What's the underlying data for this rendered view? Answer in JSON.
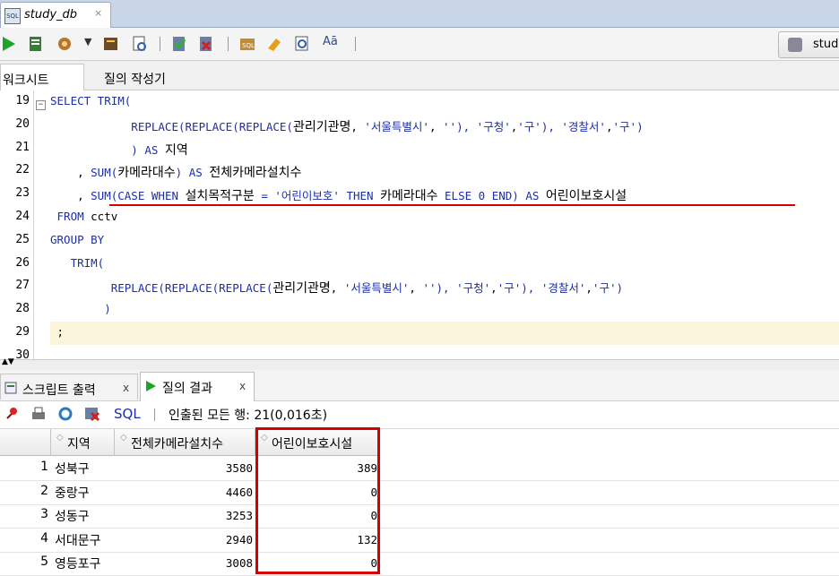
{
  "window": {
    "tab_title": "study_db",
    "tab_close": "×",
    "connection_label": "stud"
  },
  "subtabs": {
    "worksheet": "워크시트",
    "query_builder": "질의 작성기"
  },
  "editor": {
    "lines": [
      {
        "n": "19",
        "segs": [
          [
            "kw",
            "SELECT TRIM("
          ]
        ]
      },
      {
        "n": "20",
        "segs": [
          [
            "kw",
            "            REPLACE(REPLACE(REPLACE("
          ],
          [
            "kr",
            "관리기관명"
          ],
          [
            "plain",
            ", "
          ],
          [
            "str",
            "'서울특별시'"
          ],
          [
            "plain",
            ", "
          ],
          [
            "str",
            "''"
          ],
          [
            "kw",
            "), "
          ],
          [
            "str",
            "'구청'"
          ],
          [
            "plain",
            ","
          ],
          [
            "str",
            "'구'"
          ],
          [
            "kw",
            "), "
          ],
          [
            "str",
            "'경찰서'"
          ],
          [
            "plain",
            ","
          ],
          [
            "str",
            "'구'"
          ],
          [
            "kw",
            ")"
          ]
        ]
      },
      {
        "n": "21",
        "segs": [
          [
            "kw",
            "            ) AS "
          ],
          [
            "kr",
            "지역"
          ]
        ]
      },
      {
        "n": "22",
        "segs": [
          [
            "plain",
            "    , "
          ],
          [
            "kw",
            "SUM("
          ],
          [
            "kr",
            "카메라대수"
          ],
          [
            "kw",
            ") AS "
          ],
          [
            "kr",
            "전체카메라설치수"
          ]
        ]
      },
      {
        "n": "23",
        "segs": [
          [
            "plain",
            "    , "
          ],
          [
            "kw",
            "SUM(CASE WHEN "
          ],
          [
            "kr",
            "설치목적구분"
          ],
          [
            "kw",
            " = "
          ],
          [
            "str",
            "'어린이보호'"
          ],
          [
            "kw",
            " THEN "
          ],
          [
            "kr",
            "카메라대수"
          ],
          [
            "kw",
            " ELSE 0 END) AS "
          ],
          [
            "kr",
            "어린이보호시설"
          ]
        ]
      },
      {
        "n": "24",
        "segs": [
          [
            "kw",
            " FROM "
          ],
          [
            "plain",
            "cctv"
          ]
        ]
      },
      {
        "n": "25",
        "segs": [
          [
            "kw",
            "GROUP BY"
          ]
        ]
      },
      {
        "n": "26",
        "segs": [
          [
            "kw",
            "   TRIM("
          ]
        ]
      },
      {
        "n": "27",
        "segs": [
          [
            "kw",
            "         REPLACE(REPLACE(REPLACE("
          ],
          [
            "kr",
            "관리기관명"
          ],
          [
            "plain",
            ", "
          ],
          [
            "str",
            "'서울특별시'"
          ],
          [
            "plain",
            ", "
          ],
          [
            "str",
            "''"
          ],
          [
            "kw",
            "), "
          ],
          [
            "str",
            "'구청'"
          ],
          [
            "plain",
            ","
          ],
          [
            "str",
            "'구'"
          ],
          [
            "kw",
            "), "
          ],
          [
            "str",
            "'경찰서'"
          ],
          [
            "plain",
            ","
          ],
          [
            "str",
            "'구'"
          ],
          [
            "kw",
            ")"
          ]
        ]
      },
      {
        "n": "28",
        "segs": [
          [
            "kw",
            "        )"
          ]
        ]
      },
      {
        "n": "29",
        "segs": [
          [
            "plain",
            " ;"
          ]
        ]
      },
      {
        "n": "30",
        "segs": []
      }
    ]
  },
  "result_tabs": {
    "script_output": "스크립트 출력",
    "query_result": "질의 결과",
    "close": "x"
  },
  "result_toolbar": {
    "sql_label": "SQL",
    "fetch_status": "인출된 모든 행: 21(0,016초)"
  },
  "grid": {
    "columns": [
      "지역",
      "전체카메라설치수",
      "어린이보호시설"
    ],
    "rows": [
      {
        "n": "1",
        "region": "성북구",
        "total": "3580",
        "child": "389"
      },
      {
        "n": "2",
        "region": "중랑구",
        "total": "4460",
        "child": "0"
      },
      {
        "n": "3",
        "region": "성동구",
        "total": "3253",
        "child": "0"
      },
      {
        "n": "4",
        "region": "서대문구",
        "total": "2940",
        "child": "132"
      },
      {
        "n": "5",
        "region": "영등포구",
        "total": "3008",
        "child": "0"
      }
    ]
  },
  "colors": {
    "keyword": "#1c2fa8",
    "highlight": "#d40000",
    "current_line": "#fbf5dc"
  }
}
